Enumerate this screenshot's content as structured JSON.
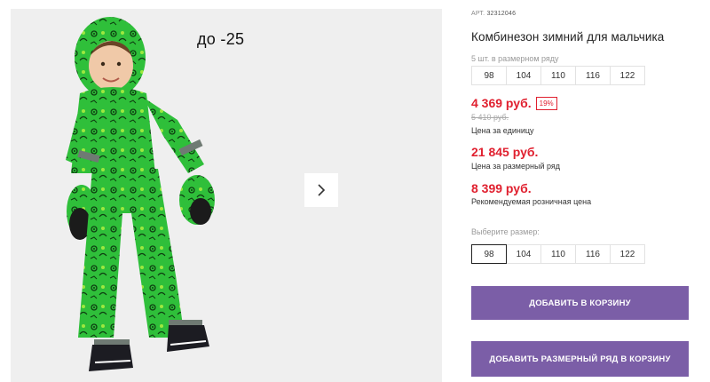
{
  "product": {
    "image_caption": "до -25",
    "article_label": "АРТ.",
    "article_number": "32312046",
    "title": "Комбинезон зимний для мальчика",
    "row_note": "5 шт. в размерном ряду",
    "row_sizes": [
      "98",
      "104",
      "110",
      "116",
      "122"
    ]
  },
  "pricing": {
    "unit_price": "4 369 руб.",
    "discount": "19%",
    "old_price": "5 410 руб.",
    "unit_caption": "Цена за единицу",
    "pack_price": "21 845 руб.",
    "pack_caption": "Цена за размерный ряд",
    "rrp_price": "8 399 руб.",
    "rrp_caption": "Рекомендуемая розничная цена"
  },
  "size_select": {
    "label": "Выберите размер:",
    "sizes": [
      "98",
      "104",
      "110",
      "116",
      "122"
    ],
    "selected": "98"
  },
  "actions": {
    "add_to_cart": "ДОБАВИТЬ В КОРЗИНУ",
    "add_pack_to_cart": "ДОБАВИТЬ РАЗМЕРНЫЙ РЯД В КОРЗИНУ"
  },
  "icons": {
    "next": "chevron-right-icon"
  },
  "colors": {
    "accent": "#7b5ea7",
    "price": "#e0202f",
    "suit": "#2fbf3a"
  }
}
